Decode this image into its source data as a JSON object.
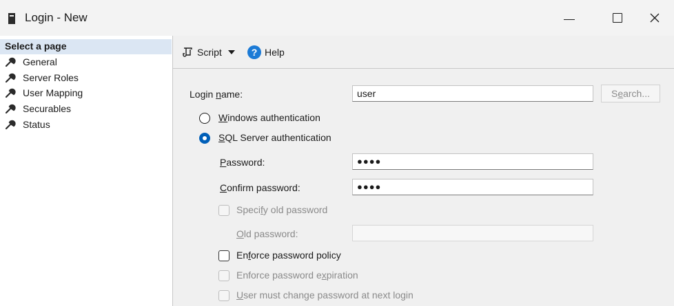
{
  "window": {
    "title": "Login - New",
    "icon": "server-icon"
  },
  "sidebar": {
    "header": "Select a page",
    "items": [
      {
        "label": "General",
        "icon": "wrench-icon"
      },
      {
        "label": "Server Roles",
        "icon": "wrench-icon"
      },
      {
        "label": "User Mapping",
        "icon": "wrench-icon"
      },
      {
        "label": "Securables",
        "icon": "wrench-icon"
      },
      {
        "label": "Status",
        "icon": "wrench-icon"
      }
    ]
  },
  "toolbar": {
    "script_label": "Script",
    "help_label": "Help"
  },
  "form": {
    "login_name_label": {
      "pre": "Login ",
      "key": "n",
      "post": "ame:"
    },
    "login_name_value": "user",
    "search_label": {
      "pre": "S",
      "key": "e",
      "post": "arch..."
    },
    "windows_auth_label": {
      "pre": "",
      "key": "W",
      "post": "indows authentication"
    },
    "sql_auth_label": {
      "pre": "",
      "key": "S",
      "post": "QL Server authentication"
    },
    "password_label": {
      "pre": "",
      "key": "P",
      "post": "assword:"
    },
    "password_value": "●●●●",
    "confirm_password_label": {
      "pre": "",
      "key": "C",
      "post": "onfirm password:"
    },
    "confirm_password_value": "●●●●",
    "specify_old_label": {
      "pre": "Speci",
      "key": "f",
      "post": "y old password"
    },
    "old_password_label": {
      "pre": "",
      "key": "O",
      "post": "ld password:"
    },
    "enforce_policy_label": {
      "pre": "En",
      "key": "f",
      "post": "orce password policy"
    },
    "enforce_expiration_label": {
      "pre": "Enforce password e",
      "key": "x",
      "post": "piration"
    },
    "must_change_label": {
      "pre": "",
      "key": "U",
      "post": "ser must change password at next login"
    }
  },
  "colors": {
    "accent": "#005fb8",
    "help": "#1c7bd6",
    "header_bg": "#dbe6f3"
  }
}
